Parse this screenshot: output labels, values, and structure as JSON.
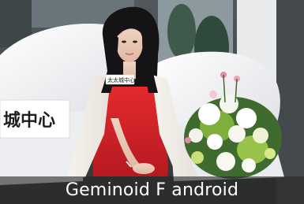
{
  "caption": {
    "text": "Geminoid F android"
  },
  "scene": {
    "backdrop_sign_text": "城中心",
    "name_badge_text": "太太城中心"
  },
  "colors": {
    "dress": "#d8232a",
    "shawl": "#f2eee8",
    "backdrop": "#f4f4f6",
    "hair": "#141214",
    "caption_bar": "#3a3a3a",
    "caption_text": "#ffffff"
  }
}
